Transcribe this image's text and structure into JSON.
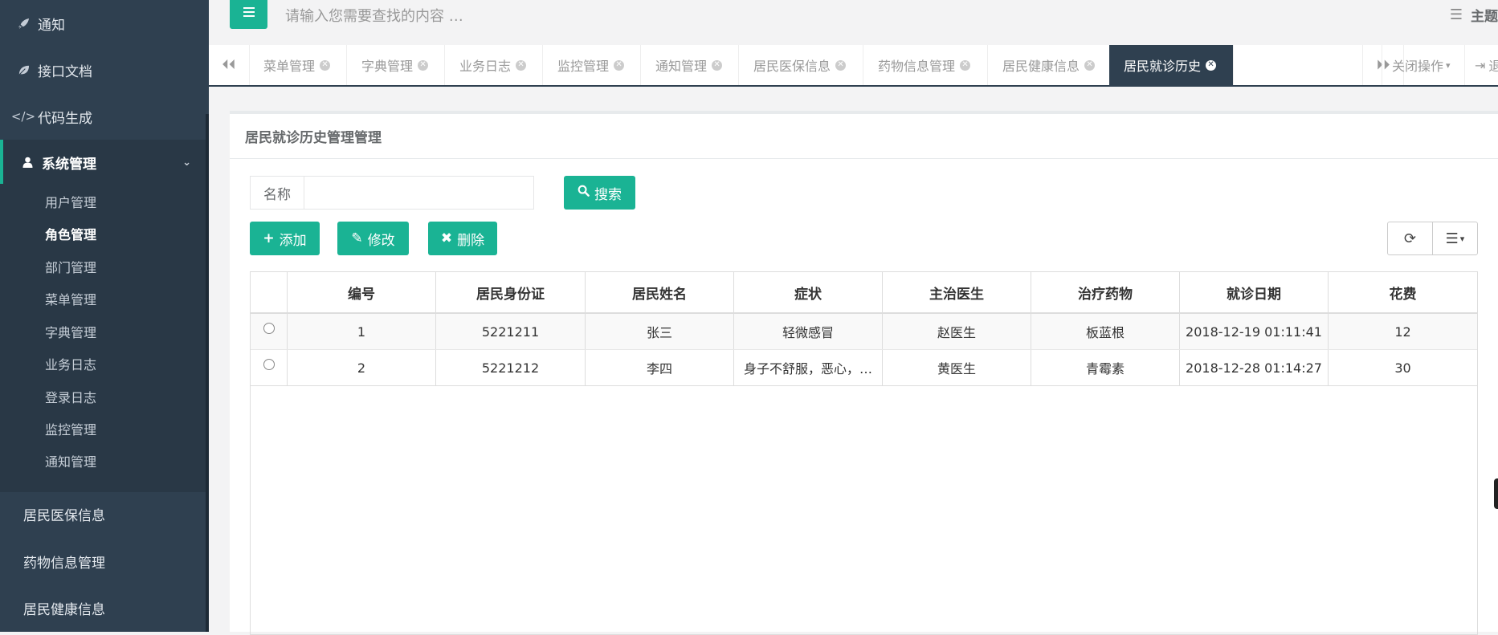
{
  "topbar": {
    "search_placeholder": "请输入您需要查找的内容 …",
    "theme_label": "主题"
  },
  "sidebar": {
    "items": [
      {
        "label": "通知",
        "icon": "rocket-icon"
      },
      {
        "label": "接口文档",
        "icon": "leaf-icon"
      },
      {
        "label": "代码生成",
        "icon": "code-icon"
      },
      {
        "label": "系统管理",
        "icon": "user-icon"
      }
    ],
    "submenu": [
      "用户管理",
      "角色管理",
      "部门管理",
      "菜单管理",
      "字典管理",
      "业务日志",
      "登录日志",
      "监控管理",
      "通知管理"
    ],
    "bottom": [
      "居民医保信息",
      "药物信息管理",
      "居民健康信息"
    ]
  },
  "tabs": {
    "items": [
      "菜单管理",
      "字典管理",
      "业务日志",
      "监控管理",
      "通知管理",
      "居民医保信息",
      "药物信息管理",
      "居民健康信息",
      "居民就诊历史"
    ],
    "active": "居民就诊历史",
    "close_ops_label": "关闭操作",
    "logout_label": "退出"
  },
  "panel": {
    "title": "居民就诊历史管理管理",
    "search_label": "名称",
    "search_value": "",
    "search_button": "搜索",
    "add_button": "添加",
    "edit_button": "修改",
    "delete_button": "删除"
  },
  "table": {
    "headers": [
      "编号",
      "居民身份证",
      "居民姓名",
      "症状",
      "主治医生",
      "治疗药物",
      "就诊日期",
      "花费"
    ],
    "rows": [
      [
        "1",
        "5221211",
        "张三",
        "轻微感冒",
        "赵医生",
        "板蓝根",
        "2018-12-19 01:11:41",
        "12"
      ],
      [
        "2",
        "5221212",
        "李四",
        "身子不舒服，恶心，…",
        "黄医生",
        "青霉素",
        "2018-12-28 01:14:27",
        "30"
      ]
    ]
  },
  "colors": {
    "accent": "#1ab394",
    "sidebar_bg": "#2f4050",
    "submenu_bg": "#293846"
  }
}
